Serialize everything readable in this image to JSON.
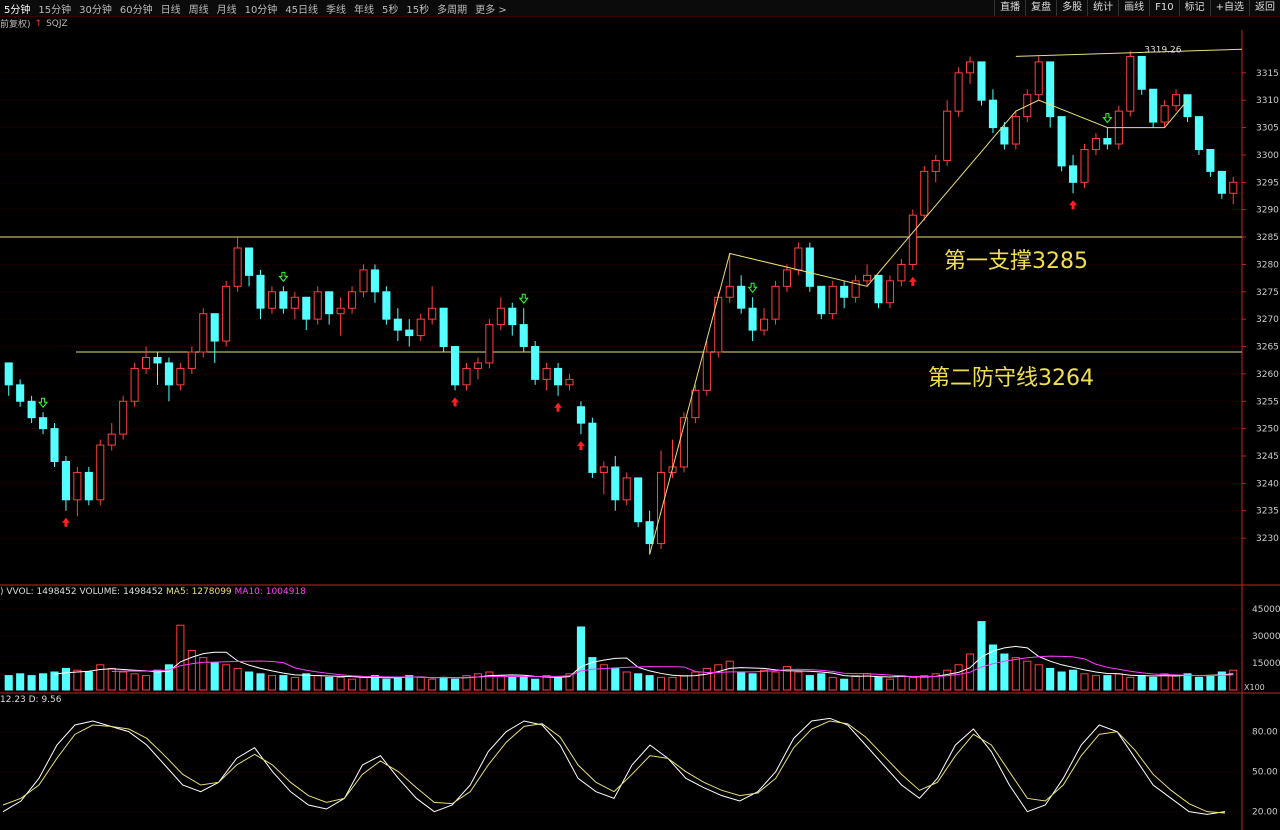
{
  "toolbar": {
    "timeframes": [
      "5分钟",
      "15分钟",
      "30分钟",
      "60分钟",
      "日线",
      "周线",
      "月线",
      "10分钟",
      "45日线",
      "季线",
      "年线",
      "5秒",
      "15秒",
      "多周期",
      "更多 >"
    ],
    "right_buttons": [
      "直播",
      "复盘",
      "多股",
      "统计",
      "画线",
      "F10",
      "标记",
      "+自选",
      "返回"
    ]
  },
  "subbar": {
    "adjust_label": "前复权)",
    "symbol": "SQJZ"
  },
  "annotations": {
    "support1": "第一支撑3285",
    "support2": "第二防守线3264",
    "peak_label": "3319.26"
  },
  "volume_legend": {
    "vvol": "VVOL: 1498452",
    "volume": "VOLUME: 1498452",
    "ma5": "MA5: 1278099",
    "ma10": "MA10: 1004918",
    "scale_label": "X100"
  },
  "kdj_legend": "12.23  D: 9.56",
  "colors": {
    "up": "#ff4040",
    "down": "#54ffff",
    "support": "#e8e07a",
    "ma5": "#ffffff",
    "ma10": "#ff40ff",
    "k": "#ffffff",
    "d": "#e8e07a",
    "grid": "#3a0000",
    "axis": "#cc2222"
  },
  "chart_data": [
    {
      "type": "candlestick",
      "y_ticks": [
        3230,
        3235,
        3240,
        3245,
        3250,
        3255,
        3260,
        3265,
        3270,
        3275,
        3280,
        3285,
        3290,
        3295,
        3300,
        3305,
        3310,
        3315
      ],
      "ylim": [
        3226,
        3321
      ],
      "horizontal_lines": [
        3285,
        3264
      ],
      "candles": [
        [
          3262,
          3262,
          3256,
          3258
        ],
        [
          3258,
          3259,
          3254,
          3255
        ],
        [
          3255,
          3256,
          3251,
          3252
        ],
        [
          3252,
          3253,
          3249,
          3250
        ],
        [
          3250,
          3251,
          3243,
          3244
        ],
        [
          3244,
          3245,
          3235,
          3237
        ],
        [
          3237,
          3243,
          3234,
          3242
        ],
        [
          3242,
          3243,
          3236,
          3237
        ],
        [
          3237,
          3248,
          3236,
          3247
        ],
        [
          3247,
          3251,
          3246,
          3249
        ],
        [
          3249,
          3256,
          3248,
          3255
        ],
        [
          3255,
          3262,
          3254,
          3261
        ],
        [
          3261,
          3265,
          3260,
          3263
        ],
        [
          3263,
          3264,
          3258,
          3262
        ],
        [
          3262,
          3263,
          3255,
          3258
        ],
        [
          3258,
          3262,
          3257,
          3261
        ],
        [
          3261,
          3265,
          3260,
          3264
        ],
        [
          3264,
          3272,
          3263,
          3271
        ],
        [
          3271,
          3270,
          3262,
          3266
        ],
        [
          3266,
          3277,
          3265,
          3276
        ],
        [
          3276,
          3285,
          3275,
          3283
        ],
        [
          3283,
          3282,
          3276,
          3278
        ],
        [
          3278,
          3279,
          3270,
          3272
        ],
        [
          3272,
          3276,
          3271,
          3275
        ],
        [
          3275,
          3276,
          3271,
          3272
        ],
        [
          3272,
          3275,
          3270,
          3274
        ],
        [
          3274,
          3273,
          3268,
          3270
        ],
        [
          3270,
          3276,
          3269,
          3275
        ],
        [
          3275,
          3274,
          3269,
          3271
        ],
        [
          3271,
          3274,
          3267,
          3272
        ],
        [
          3272,
          3276,
          3271,
          3275
        ],
        [
          3275,
          3280,
          3274,
          3279
        ],
        [
          3279,
          3280,
          3273,
          3275
        ],
        [
          3275,
          3276,
          3269,
          3270
        ],
        [
          3270,
          3272,
          3266,
          3268
        ],
        [
          3268,
          3270,
          3265,
          3267
        ],
        [
          3267,
          3271,
          3266,
          3270
        ],
        [
          3270,
          3276,
          3269,
          3272
        ],
        [
          3272,
          3270,
          3264,
          3265
        ],
        [
          3265,
          3264,
          3257,
          3258
        ],
        [
          3258,
          3262,
          3257,
          3261
        ],
        [
          3261,
          3263,
          3259,
          3262
        ],
        [
          3262,
          3270,
          3261,
          3269
        ],
        [
          3269,
          3274,
          3268,
          3272
        ],
        [
          3272,
          3273,
          3267,
          3269
        ],
        [
          3269,
          3272,
          3264,
          3265
        ],
        [
          3265,
          3266,
          3258,
          3259
        ],
        [
          3259,
          3262,
          3257,
          3261
        ],
        [
          3261,
          3262,
          3256,
          3258
        ],
        [
          3258,
          3260,
          3257,
          3259
        ],
        [
          3254,
          3255,
          3249,
          3251
        ],
        [
          3251,
          3252,
          3241,
          3242
        ],
        [
          3242,
          3244,
          3238,
          3243
        ],
        [
          3243,
          3245,
          3235,
          3237
        ],
        [
          3237,
          3242,
          3236,
          3241
        ],
        [
          3241,
          3241,
          3232,
          3233
        ],
        [
          3233,
          3235,
          3227,
          3229
        ],
        [
          3229,
          3246,
          3228,
          3242
        ],
        [
          3242,
          3248,
          3241,
          3243
        ],
        [
          3243,
          3253,
          3242,
          3252
        ],
        [
          3252,
          3258,
          3251,
          3257
        ],
        [
          3257,
          3266,
          3256,
          3264
        ],
        [
          3264,
          3275,
          3263,
          3274
        ],
        [
          3274,
          3282,
          3273,
          3276
        ],
        [
          3276,
          3278,
          3271,
          3272
        ],
        [
          3272,
          3274,
          3266,
          3268
        ],
        [
          3268,
          3272,
          3267,
          3270
        ],
        [
          3270,
          3277,
          3269,
          3276
        ],
        [
          3276,
          3280,
          3275,
          3279
        ],
        [
          3279,
          3284,
          3278,
          3283
        ],
        [
          3283,
          3284,
          3275,
          3276
        ],
        [
          3276,
          3275,
          3270,
          3271
        ],
        [
          3271,
          3277,
          3270,
          3276
        ],
        [
          3276,
          3277,
          3272,
          3274
        ],
        [
          3274,
          3278,
          3273,
          3277
        ],
        [
          3277,
          3280,
          3276,
          3278
        ],
        [
          3278,
          3277,
          3272,
          3273
        ],
        [
          3273,
          3278,
          3272,
          3277
        ],
        [
          3277,
          3281,
          3276,
          3280
        ],
        [
          3280,
          3290,
          3279,
          3289
        ],
        [
          3289,
          3298,
          3288,
          3297
        ],
        [
          3297,
          3300,
          3295,
          3299
        ],
        [
          3299,
          3310,
          3298,
          3308
        ],
        [
          3308,
          3316,
          3307,
          3315
        ],
        [
          3315,
          3318,
          3313,
          3317
        ],
        [
          3317,
          3316,
          3309,
          3310
        ],
        [
          3310,
          3312,
          3304,
          3305
        ],
        [
          3305,
          3306,
          3301,
          3302
        ],
        [
          3302,
          3308,
          3301,
          3307
        ],
        [
          3307,
          3312,
          3306,
          3311
        ],
        [
          3311,
          3318,
          3310,
          3317
        ],
        [
          3317,
          3316,
          3305,
          3307
        ],
        [
          3307,
          3306,
          3297,
          3298
        ],
        [
          3298,
          3300,
          3293,
          3295
        ],
        [
          3295,
          3302,
          3294,
          3301
        ],
        [
          3301,
          3304,
          3300,
          3303
        ],
        [
          3303,
          3305,
          3301,
          3302
        ],
        [
          3302,
          3309,
          3301,
          3308
        ],
        [
          3308,
          3319,
          3307,
          3318
        ],
        [
          3318,
          3317,
          3311,
          3312
        ],
        [
          3312,
          3311,
          3305,
          3306
        ],
        [
          3306,
          3310,
          3305,
          3309
        ],
        [
          3309,
          3312,
          3308,
          3311
        ],
        [
          3311,
          3310,
          3306,
          3307
        ],
        [
          3307,
          3306,
          3300,
          3301
        ],
        [
          3301,
          3300,
          3296,
          3297
        ],
        [
          3297,
          3296,
          3292,
          3293
        ],
        [
          3293,
          3296,
          3291,
          3295
        ]
      ],
      "markers": {
        "red_up": [
          5,
          39,
          48,
          50,
          79,
          93,
          108
        ],
        "green_down": [
          3,
          24,
          45,
          65,
          96
        ]
      }
    },
    {
      "type": "bar",
      "y_ticks": [
        15000,
        30000,
        45000
      ],
      "values": [
        8,
        9,
        8,
        9,
        10,
        12,
        11,
        10,
        14,
        12,
        10,
        9,
        8,
        11,
        14,
        36,
        22,
        18,
        15,
        14,
        12,
        10,
        9,
        8,
        8,
        7,
        9,
        8,
        7,
        7,
        6,
        7,
        8,
        6,
        7,
        8,
        7,
        6,
        7,
        6,
        8,
        9,
        10,
        8,
        7,
        7,
        6,
        8,
        7,
        9,
        35,
        18,
        14,
        12,
        10,
        9,
        8,
        7,
        7,
        8,
        10,
        12,
        14,
        16,
        10,
        9,
        11,
        10,
        13,
        10,
        8,
        9,
        7,
        6,
        8,
        9,
        7,
        6,
        8,
        7,
        8,
        9,
        11,
        14,
        20,
        38,
        25,
        20,
        18,
        16,
        14,
        12,
        10,
        11,
        9,
        8,
        8,
        9,
        7,
        8,
        7,
        9,
        8,
        9,
        7,
        8,
        10,
        11,
        12,
        13
      ]
    },
    {
      "type": "line",
      "y_ticks": [
        20,
        50,
        80
      ],
      "series": [
        {
          "name": "K",
          "values": [
            20,
            28,
            45,
            70,
            85,
            88,
            84,
            80,
            70,
            55,
            40,
            35,
            42,
            60,
            68,
            50,
            35,
            25,
            22,
            30,
            55,
            62,
            45,
            30,
            20,
            25,
            40,
            65,
            80,
            88,
            85,
            70,
            45,
            35,
            30,
            55,
            70,
            60,
            45,
            38,
            32,
            28,
            35,
            50,
            75,
            88,
            90,
            85,
            70,
            55,
            40,
            30,
            45,
            70,
            82,
            65,
            40,
            20,
            25,
            45,
            70,
            85,
            80,
            60,
            40,
            30,
            20,
            18,
            20
          ]
        },
        {
          "name": "D",
          "values": [
            25,
            30,
            40,
            60,
            78,
            85,
            84,
            82,
            75,
            62,
            48,
            40,
            42,
            55,
            63,
            55,
            42,
            32,
            27,
            30,
            48,
            58,
            50,
            38,
            27,
            26,
            35,
            55,
            72,
            84,
            86,
            76,
            55,
            42,
            35,
            48,
            62,
            60,
            50,
            42,
            36,
            32,
            34,
            45,
            68,
            82,
            88,
            86,
            76,
            62,
            48,
            36,
            42,
            62,
            78,
            70,
            50,
            30,
            28,
            40,
            62,
            78,
            80,
            66,
            48,
            36,
            26,
            20,
            19
          ]
        }
      ]
    }
  ]
}
